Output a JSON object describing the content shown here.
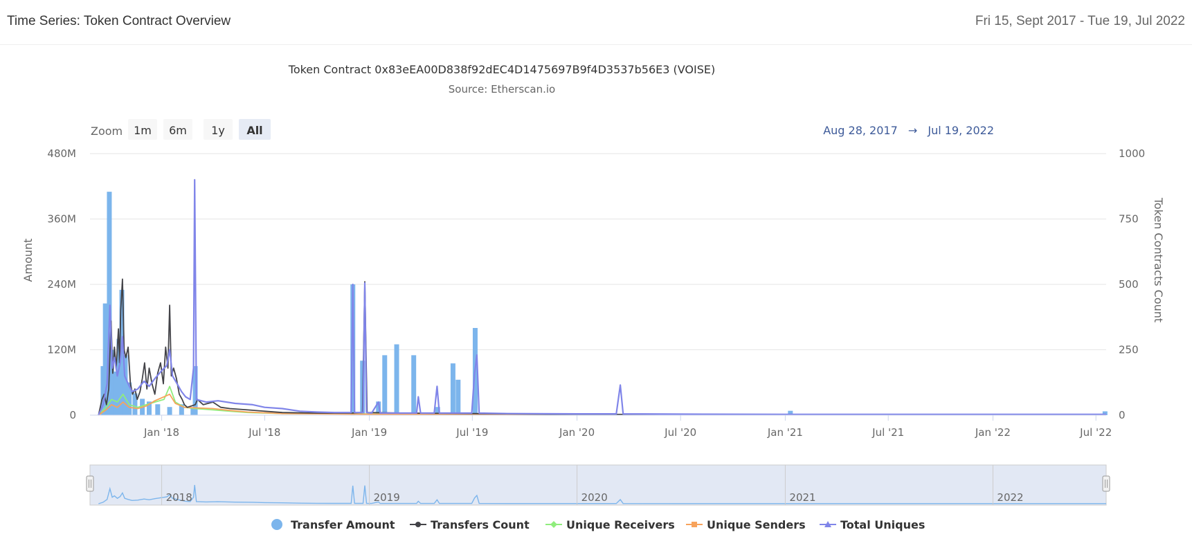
{
  "header": {
    "title": "Time Series: Token Contract Overview",
    "date_range": "Fri 15, Sept 2017 - Tue 19, Jul 2022"
  },
  "colors": {
    "transfer_amount": "#7cb5ec",
    "transfers_count": "#434348",
    "unique_receivers": "#90ed7d",
    "unique_senders": "#f7a35c",
    "total_uniques": "#8085e9",
    "grid": "#e6e6e6",
    "navigator_mask": "#dfe5f3",
    "range_text": "#3d5a99"
  },
  "chart_data": {
    "type": "line",
    "title": "Token Contract 0x83eEA00D838f92dEC4D1475697B9f4D3537b56E3 (VOISE)",
    "subtitle": "Source: Etherscan.io",
    "zoom": {
      "label": "Zoom",
      "buttons": [
        "1m",
        "6m",
        "1y",
        "All"
      ],
      "selected": "All"
    },
    "range": {
      "from": "Aug 28, 2017",
      "arrow": "→",
      "to": "Jul 19, 2022"
    },
    "x_axis": {
      "range": [
        "2017-08-28",
        "2022-07-19"
      ],
      "ticks": [
        {
          "date": "2018-01-01",
          "label": "Jan '18"
        },
        {
          "date": "2018-07-01",
          "label": "Jul '18"
        },
        {
          "date": "2019-01-01",
          "label": "Jan '19"
        },
        {
          "date": "2019-07-01",
          "label": "Jul '19"
        },
        {
          "date": "2020-01-01",
          "label": "Jan '20"
        },
        {
          "date": "2020-07-01",
          "label": "Jul '20"
        },
        {
          "date": "2021-01-01",
          "label": "Jan '21"
        },
        {
          "date": "2021-07-01",
          "label": "Jul '21"
        },
        {
          "date": "2022-01-01",
          "label": "Jan '22"
        },
        {
          "date": "2022-07-01",
          "label": "Jul '22"
        }
      ]
    },
    "y_left": {
      "label": "Amount",
      "range": [
        0,
        480000000
      ],
      "ticks": [
        {
          "value": 0,
          "label": "0"
        },
        {
          "value": 120000000,
          "label": "120M"
        },
        {
          "value": 240000000,
          "label": "240M"
        },
        {
          "value": 360000000,
          "label": "360M"
        },
        {
          "value": 480000000,
          "label": "480M"
        }
      ]
    },
    "y_right": {
      "label": "Token Contracts Count",
      "range": [
        0,
        1000
      ],
      "ticks": [
        {
          "value": 0,
          "label": "0"
        },
        {
          "value": 250,
          "label": "250"
        },
        {
          "value": 500,
          "label": "500"
        },
        {
          "value": 750,
          "label": "750"
        },
        {
          "value": 1000,
          "label": "1000"
        }
      ]
    },
    "legend_position": "bottom-center",
    "navigator": {
      "labels": [
        {
          "date": "2018-01-01",
          "label": "2018"
        },
        {
          "date": "2019-01-01",
          "label": "2019"
        },
        {
          "date": "2020-01-01",
          "label": "2020"
        },
        {
          "date": "2021-01-01",
          "label": "2021"
        },
        {
          "date": "2022-01-01",
          "label": "2022"
        }
      ]
    },
    "series": [
      {
        "name": "Transfer Amount",
        "axis": "left",
        "kind": "column",
        "points": [
          [
            "2017-09-20",
            90000000
          ],
          [
            "2017-09-24",
            205000000
          ],
          [
            "2017-09-27",
            200000000
          ],
          [
            "2017-10-01",
            410000000
          ],
          [
            "2017-10-05",
            120000000
          ],
          [
            "2017-10-12",
            80000000
          ],
          [
            "2017-10-18",
            140000000
          ],
          [
            "2017-10-23",
            230000000
          ],
          [
            "2017-10-29",
            110000000
          ],
          [
            "2017-11-05",
            60000000
          ],
          [
            "2017-11-15",
            40000000
          ],
          [
            "2017-11-28",
            30000000
          ],
          [
            "2017-12-10",
            25000000
          ],
          [
            "2017-12-25",
            20000000
          ],
          [
            "2018-01-15",
            15000000
          ],
          [
            "2018-02-05",
            20000000
          ],
          [
            "2018-02-25",
            12000000
          ],
          [
            "2018-03-01",
            90000000
          ],
          [
            "2018-12-03",
            240000000
          ],
          [
            "2018-12-20",
            100000000
          ],
          [
            "2019-01-17",
            25000000
          ],
          [
            "2019-01-28",
            110000000
          ],
          [
            "2019-02-18",
            130000000
          ],
          [
            "2019-03-20",
            110000000
          ],
          [
            "2019-05-01",
            15000000
          ],
          [
            "2019-05-28",
            95000000
          ],
          [
            "2019-06-06",
            65000000
          ],
          [
            "2019-07-06",
            160000000
          ],
          [
            "2021-01-10",
            8000000
          ],
          [
            "2022-07-17",
            7000000
          ]
        ]
      },
      {
        "name": "Transfers Count",
        "axis": "right",
        "kind": "line",
        "points": [
          [
            "2017-09-12",
            0
          ],
          [
            "2017-09-18",
            60
          ],
          [
            "2017-09-22",
            80
          ],
          [
            "2017-09-26",
            40
          ],
          [
            "2017-09-30",
            100
          ],
          [
            "2017-10-04",
            360
          ],
          [
            "2017-10-07",
            160
          ],
          [
            "2017-10-10",
            260
          ],
          [
            "2017-10-13",
            180
          ],
          [
            "2017-10-17",
            330
          ],
          [
            "2017-10-19",
            200
          ],
          [
            "2017-10-21",
            400
          ],
          [
            "2017-10-24",
            520
          ],
          [
            "2017-10-27",
            250
          ],
          [
            "2017-10-30",
            220
          ],
          [
            "2017-11-03",
            260
          ],
          [
            "2017-11-07",
            120
          ],
          [
            "2017-11-11",
            80
          ],
          [
            "2017-11-15",
            100
          ],
          [
            "2017-11-19",
            60
          ],
          [
            "2017-11-24",
            90
          ],
          [
            "2017-11-28",
            140
          ],
          [
            "2017-12-02",
            200
          ],
          [
            "2017-12-06",
            100
          ],
          [
            "2017-12-10",
            180
          ],
          [
            "2017-12-15",
            120
          ],
          [
            "2017-12-20",
            80
          ],
          [
            "2017-12-25",
            160
          ],
          [
            "2017-12-30",
            200
          ],
          [
            "2018-01-04",
            120
          ],
          [
            "2018-01-08",
            260
          ],
          [
            "2018-01-12",
            180
          ],
          [
            "2018-01-15",
            420
          ],
          [
            "2018-01-18",
            150
          ],
          [
            "2018-01-22",
            180
          ],
          [
            "2018-01-27",
            140
          ],
          [
            "2018-02-01",
            80
          ],
          [
            "2018-02-06",
            60
          ],
          [
            "2018-02-10",
            40
          ],
          [
            "2018-02-15",
            30
          ],
          [
            "2018-03-01",
            40
          ],
          [
            "2018-03-05",
            60
          ],
          [
            "2018-03-15",
            40
          ],
          [
            "2018-04-01",
            50
          ],
          [
            "2018-04-15",
            30
          ],
          [
            "2018-05-01",
            25
          ],
          [
            "2018-06-01",
            20
          ],
          [
            "2018-07-01",
            15
          ],
          [
            "2018-08-01",
            10
          ],
          [
            "2018-10-01",
            8
          ],
          [
            "2018-12-01",
            8
          ],
          [
            "2018-12-20",
            10
          ],
          [
            "2018-12-24",
            510
          ],
          [
            "2018-12-28",
            10
          ],
          [
            "2019-03-01",
            8
          ],
          [
            "2019-07-01",
            6
          ],
          [
            "2020-01-01",
            3
          ],
          [
            "2021-01-01",
            3
          ],
          [
            "2022-07-19",
            2
          ]
        ]
      },
      {
        "name": "Unique Receivers",
        "axis": "right",
        "kind": "line",
        "points": [
          [
            "2017-09-12",
            0
          ],
          [
            "2017-09-25",
            30
          ],
          [
            "2017-10-05",
            60
          ],
          [
            "2017-10-15",
            50
          ],
          [
            "2017-10-25",
            80
          ],
          [
            "2017-11-05",
            40
          ],
          [
            "2017-11-20",
            30
          ],
          [
            "2017-12-05",
            40
          ],
          [
            "2017-12-20",
            50
          ],
          [
            "2018-01-05",
            60
          ],
          [
            "2018-01-15",
            110
          ],
          [
            "2018-01-25",
            50
          ],
          [
            "2018-02-10",
            30
          ],
          [
            "2018-03-01",
            25
          ],
          [
            "2018-04-01",
            20
          ],
          [
            "2018-05-01",
            15
          ],
          [
            "2018-06-01",
            10
          ],
          [
            "2018-08-01",
            6
          ],
          [
            "2018-12-01",
            5
          ],
          [
            "2019-07-01",
            4
          ],
          [
            "2020-01-01",
            2
          ],
          [
            "2021-01-01",
            2
          ],
          [
            "2022-07-19",
            1
          ]
        ]
      },
      {
        "name": "Unique Senders",
        "axis": "right",
        "kind": "line",
        "points": [
          [
            "2017-09-12",
            0
          ],
          [
            "2017-09-25",
            20
          ],
          [
            "2017-10-05",
            40
          ],
          [
            "2017-10-15",
            30
          ],
          [
            "2017-10-25",
            50
          ],
          [
            "2017-11-05",
            30
          ],
          [
            "2017-11-20",
            25
          ],
          [
            "2017-12-05",
            35
          ],
          [
            "2017-12-20",
            55
          ],
          [
            "2018-01-05",
            70
          ],
          [
            "2018-01-15",
            80
          ],
          [
            "2018-01-25",
            45
          ],
          [
            "2018-02-10",
            30
          ],
          [
            "2018-03-01",
            28
          ],
          [
            "2018-04-01",
            25
          ],
          [
            "2018-05-01",
            18
          ],
          [
            "2018-06-01",
            12
          ],
          [
            "2018-08-01",
            6
          ],
          [
            "2018-12-01",
            4
          ],
          [
            "2019-07-01",
            3
          ],
          [
            "2020-01-01",
            2
          ],
          [
            "2021-01-01",
            2
          ],
          [
            "2022-07-19",
            1
          ]
        ]
      },
      {
        "name": "Total Uniques",
        "axis": "right",
        "kind": "line",
        "points": [
          [
            "2017-09-12",
            0
          ],
          [
            "2017-09-20",
            40
          ],
          [
            "2017-09-27",
            120
          ],
          [
            "2017-10-02",
            420
          ],
          [
            "2017-10-06",
            180
          ],
          [
            "2017-10-10",
            220
          ],
          [
            "2017-10-15",
            150
          ],
          [
            "2017-10-20",
            200
          ],
          [
            "2017-10-24",
            300
          ],
          [
            "2017-10-28",
            150
          ],
          [
            "2017-11-03",
            120
          ],
          [
            "2017-11-10",
            90
          ],
          [
            "2017-11-20",
            100
          ],
          [
            "2017-12-01",
            130
          ],
          [
            "2017-12-10",
            110
          ],
          [
            "2017-12-20",
            140
          ],
          [
            "2018-01-01",
            170
          ],
          [
            "2018-01-10",
            190
          ],
          [
            "2018-01-15",
            250
          ],
          [
            "2018-01-20",
            150
          ],
          [
            "2018-01-28",
            120
          ],
          [
            "2018-02-05",
            90
          ],
          [
            "2018-02-12",
            70
          ],
          [
            "2018-02-20",
            60
          ],
          [
            "2018-02-26",
            180
          ],
          [
            "2018-02-28",
            900
          ],
          [
            "2018-03-03",
            60
          ],
          [
            "2018-03-20",
            50
          ],
          [
            "2018-04-10",
            55
          ],
          [
            "2018-05-10",
            45
          ],
          [
            "2018-06-10",
            40
          ],
          [
            "2018-07-01",
            30
          ],
          [
            "2018-08-01",
            25
          ],
          [
            "2018-09-01",
            15
          ],
          [
            "2018-10-01",
            12
          ],
          [
            "2018-11-01",
            10
          ],
          [
            "2018-11-30",
            10
          ],
          [
            "2018-12-03",
            500
          ],
          [
            "2018-12-06",
            10
          ],
          [
            "2018-12-21",
            10
          ],
          [
            "2018-12-24",
            505
          ],
          [
            "2018-12-27",
            10
          ],
          [
            "2019-01-05",
            8
          ],
          [
            "2019-01-17",
            50
          ],
          [
            "2019-01-20",
            8
          ],
          [
            "2019-03-25",
            8
          ],
          [
            "2019-03-28",
            70
          ],
          [
            "2019-04-01",
            8
          ],
          [
            "2019-04-25",
            8
          ],
          [
            "2019-04-30",
            110
          ],
          [
            "2019-05-04",
            8
          ],
          [
            "2019-06-30",
            8
          ],
          [
            "2019-07-05",
            160
          ],
          [
            "2019-07-09",
            230
          ],
          [
            "2019-07-13",
            8
          ],
          [
            "2019-09-01",
            6
          ],
          [
            "2020-01-01",
            5
          ],
          [
            "2020-03-10",
            5
          ],
          [
            "2020-03-17",
            115
          ],
          [
            "2020-03-22",
            5
          ],
          [
            "2020-07-01",
            4
          ],
          [
            "2021-01-01",
            3
          ],
          [
            "2022-01-01",
            3
          ],
          [
            "2022-07-19",
            3
          ]
        ]
      }
    ]
  }
}
